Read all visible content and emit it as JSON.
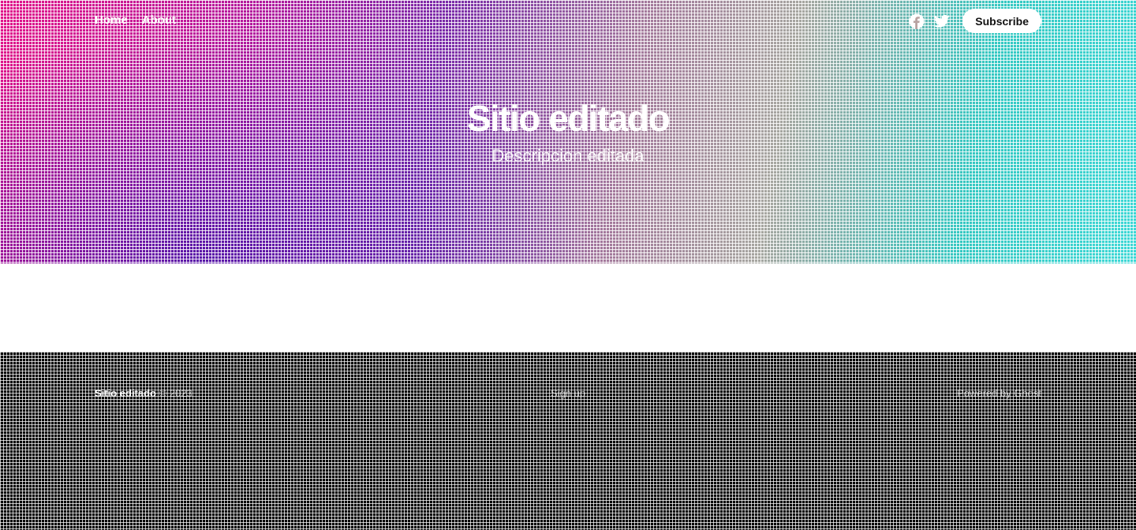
{
  "header": {
    "nav": [
      {
        "label": "Home"
      },
      {
        "label": "About"
      }
    ],
    "social": [
      {
        "icon": "facebook-icon"
      },
      {
        "icon": "twitter-icon"
      }
    ],
    "subscribe_label": "Subscribe"
  },
  "hero": {
    "title": "Sitio editado",
    "description": "Descripcion editada"
  },
  "footer": {
    "site_name": "Sitio editado",
    "copyright": "© 2023",
    "center_link": "Sign up",
    "powered_by": "Powered by Ghost"
  },
  "colors": {
    "hero_pink": "#e0158a",
    "hero_purple": "#4b1aa5",
    "hero_teal": "#3ed8d6",
    "footer_bg": "#000000"
  }
}
